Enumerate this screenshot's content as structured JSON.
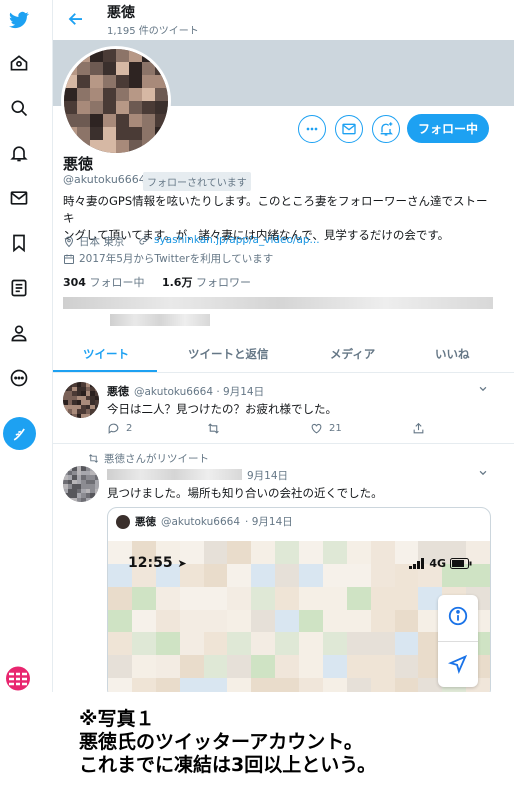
{
  "header": {
    "name": "悪徳",
    "tweet_count": "1,195 件のツイート"
  },
  "profile": {
    "name": "悪徳",
    "handle": "@akutoku6664",
    "follows_you": "フォローされています",
    "bio_lines": [
      "時々妻のGPS情報を呟いたりします。このところ妻をフォローワーさん達でストーキ",
      "ングして頂いてます。が、諸々妻には内緒なんで、見学するだけの会です。"
    ],
    "location": "日本 東京",
    "link": "syashinkan.jp/app/a_video/ap...",
    "joined": "2017年5月からTwitterを利用しています",
    "following_count": "304",
    "following_label": "フォロー中",
    "followers_count": "1.6万",
    "followers_label": "フォロワー",
    "follow_button": "フォロー中"
  },
  "tabs": [
    "ツイート",
    "ツイートと返信",
    "メディア",
    "いいね"
  ],
  "tweets": [
    {
      "name": "悪徳",
      "handle": "@akutoku6664",
      "date": "· 9月14日",
      "text": "今日は二人？見つけたの？お疲れ様でした。",
      "replies": "2",
      "likes": "21"
    },
    {
      "retweet_label": "悪徳さんがリツイート",
      "date": "9月14日",
      "text": "見つけました。場所も知り合いの会社の近くでした。",
      "quoted": {
        "name": "悪徳",
        "handle": "@akutoku6664",
        "date": "· 9月14日",
        "phone_time": "12:55",
        "network": "4G"
      }
    }
  ],
  "caption": [
    "※写真１",
    "悪徳氏のツイッターアカウント。",
    "これまでに凍結は3回以上という。"
  ],
  "colors": {
    "accent": "#1da1f2",
    "secondary_text": "#657786",
    "divider": "#e6ecf0",
    "banner": "#ccd6dd"
  },
  "icons": {
    "nav": [
      "twitter-bird-icon",
      "home-icon",
      "explore-search-icon",
      "notifications-bell-icon",
      "messages-envelope-icon",
      "bookmark-icon",
      "lists-icon",
      "profile-person-icon",
      "more-circle-icon",
      "compose-tweet-icon"
    ]
  }
}
